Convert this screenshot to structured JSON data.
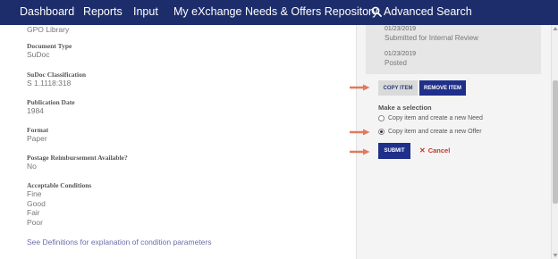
{
  "nav": {
    "items": [
      "Dashboard",
      "Reports",
      "Input",
      "My eXchange",
      "Needs & Offers Repository"
    ],
    "search_label": "Advanced Search",
    "search_icon": "search-icon"
  },
  "details": {
    "library": "GPO Library",
    "document_type": {
      "label": "Document Type",
      "value": "SuDoc"
    },
    "sudoc": {
      "label": "SuDoc Classification",
      "value": "S 1.1118:318"
    },
    "pub_date": {
      "label": "Publication Date",
      "value": "1984"
    },
    "format": {
      "label": "Format",
      "value": "Paper"
    },
    "postage": {
      "label": "Postage Reimbursement Available?",
      "value": "No"
    },
    "conditions": {
      "label": "Acceptable Conditions",
      "values": [
        "Fine",
        "Good",
        "Fair",
        "Poor"
      ]
    },
    "definitions_link": "See Definitions for explanation of condition parameters"
  },
  "history": [
    {
      "date": "01/23/2019",
      "status": "Submitted for Internal Review"
    },
    {
      "date": "01/23/2019",
      "status": "Posted"
    }
  ],
  "actions": {
    "copy_item": "COPY ITEM",
    "remove_item": "REMOVE ITEM",
    "make_selection": "Make a selection",
    "options": [
      {
        "label": "Copy item and create a new Need",
        "checked": false
      },
      {
        "label": "Copy item and create a new Offer",
        "checked": true
      }
    ],
    "submit": "SUBMIT",
    "cancel": "Cancel"
  },
  "colors": {
    "nav_bg": "#1d2d6b",
    "primary_button": "#1f2f8a",
    "cancel": "#c0392b",
    "arrow": "#e07a5f"
  }
}
